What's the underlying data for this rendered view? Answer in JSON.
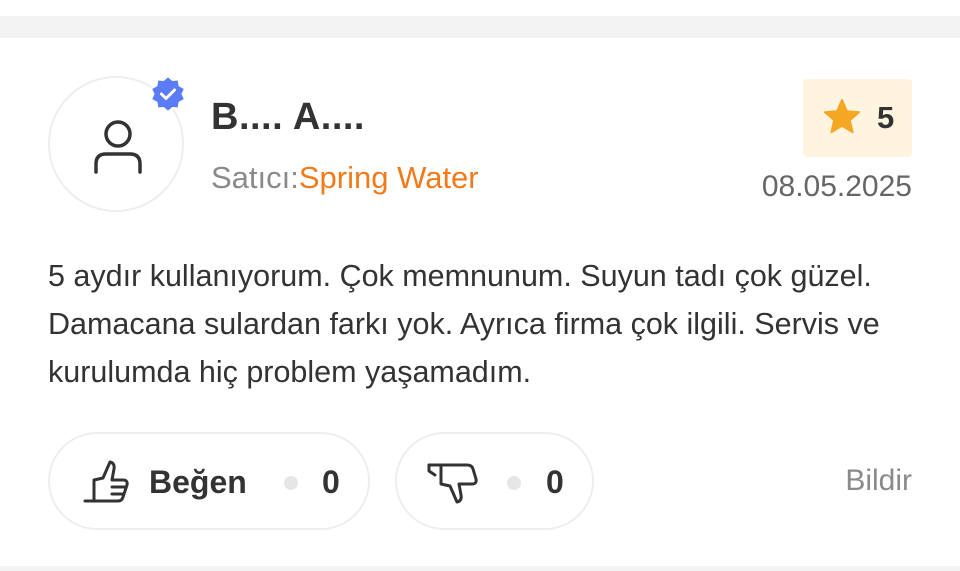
{
  "review": {
    "author": "B.... A....",
    "seller_label": "Satıcı:",
    "seller_name": "Spring Water",
    "rating": "5",
    "date": "08.05.2025",
    "comment": "5 aydır kullanıyorum. Çok memnunum. Suyun tadı çok güzel. Damacana sulardan farkı yok. Ayrıca firma çok ilgili. Servis ve kurulumda hiç problem yaşamadım.",
    "verified": true
  },
  "actions": {
    "like_label": "Beğen",
    "like_count": "0",
    "dislike_count": "0",
    "report_label": "Bildir"
  },
  "icons": {
    "avatar": "user-icon",
    "verified": "verified-badge-icon",
    "rating": "star-icon",
    "like": "thumbs-up-icon",
    "dislike": "thumbs-down-icon"
  },
  "colors": {
    "brand": "#f27a1a",
    "star": "#f5a623",
    "verified": "#5b7cf7",
    "rating_bg": "#fff4e0"
  }
}
